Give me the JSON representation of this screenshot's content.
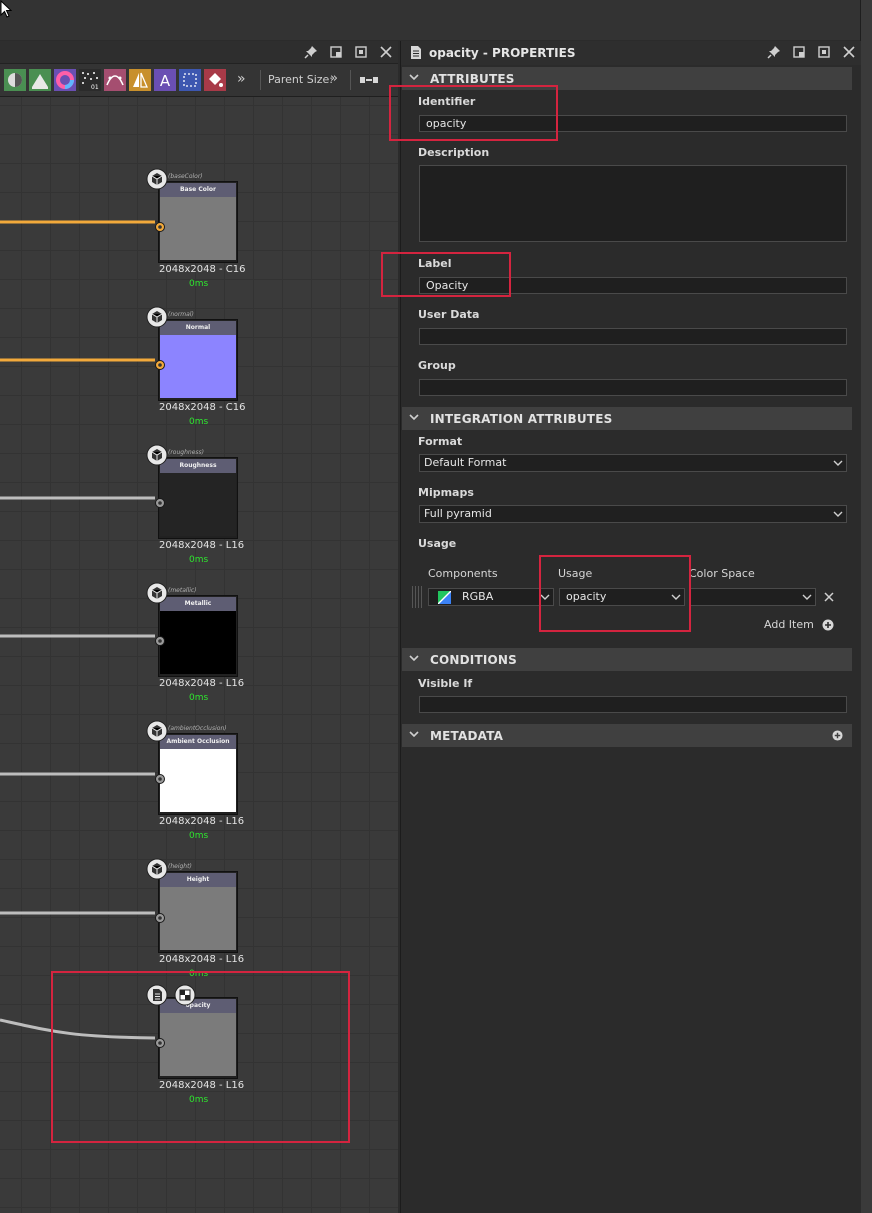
{
  "graph": {
    "toolbar": {
      "parent_size_label": "Parent Size:",
      "more": "»"
    },
    "nodes": [
      {
        "tag": "(baseColor)",
        "title": "Base Color",
        "resolution": "2048x2048 - C16",
        "time": "0ms",
        "preview_color": "#7b7b7b",
        "port_color": "#f2a93b"
      },
      {
        "tag": "(normal)",
        "title": "Normal",
        "resolution": "2048x2048 - C16",
        "time": "0ms",
        "preview_color": "#8c84ff",
        "port_color": "#f2a93b"
      },
      {
        "tag": "(roughness)",
        "title": "Roughness",
        "resolution": "2048x2048 - L16",
        "time": "0ms",
        "preview_color": "#242424",
        "port_color": "#9a9a9a"
      },
      {
        "tag": "(metallic)",
        "title": "Metallic",
        "resolution": "2048x2048 - L16",
        "time": "0ms",
        "preview_color": "#000000",
        "port_color": "#9a9a9a"
      },
      {
        "tag": "(ambientOcclusion)",
        "title": "Ambient Occlusion",
        "resolution": "2048x2048 - L16",
        "time": "0ms",
        "preview_color": "#ffffff",
        "port_color": "#9a9a9a"
      },
      {
        "tag": "(height)",
        "title": "Height",
        "resolution": "2048x2048 - L16",
        "time": "0ms",
        "preview_color": "#7b7b7b",
        "port_color": "#9a9a9a"
      },
      {
        "tag": "",
        "title": "opacity",
        "resolution": "2048x2048 - L16",
        "time": "0ms",
        "preview_color": "#7b7b7b",
        "port_color": "#9a9a9a"
      }
    ]
  },
  "properties": {
    "title": "opacity - PROPERTIES",
    "sections": {
      "attributes": "ATTRIBUTES",
      "integration": "INTEGRATION ATTRIBUTES",
      "conditions": "CONDITIONS",
      "metadata": "METADATA"
    },
    "fields": {
      "identifier": {
        "label": "Identifier",
        "value": "opacity"
      },
      "description": {
        "label": "Description",
        "value": ""
      },
      "label": {
        "label": "Label",
        "value": "Opacity"
      },
      "user_data": {
        "label": "User Data",
        "value": ""
      },
      "group": {
        "label": "Group",
        "value": ""
      },
      "format": {
        "label": "Format",
        "value": "Default Format"
      },
      "mipmaps": {
        "label": "Mipmaps",
        "value": "Full pyramid"
      },
      "usage": {
        "label": "Usage"
      },
      "visible_if": {
        "label": "Visible If",
        "value": ""
      }
    },
    "usage_table": {
      "headers": [
        "Components",
        "Usage",
        "Color Space"
      ],
      "rows": [
        {
          "components": "RGBA",
          "usage": "opacity",
          "color_space": ""
        }
      ],
      "add_item": "Add Item"
    }
  },
  "colors": {
    "highlight": "#d4243f",
    "accent_orange": "#f2a93b",
    "time_green": "#2ee62e"
  }
}
